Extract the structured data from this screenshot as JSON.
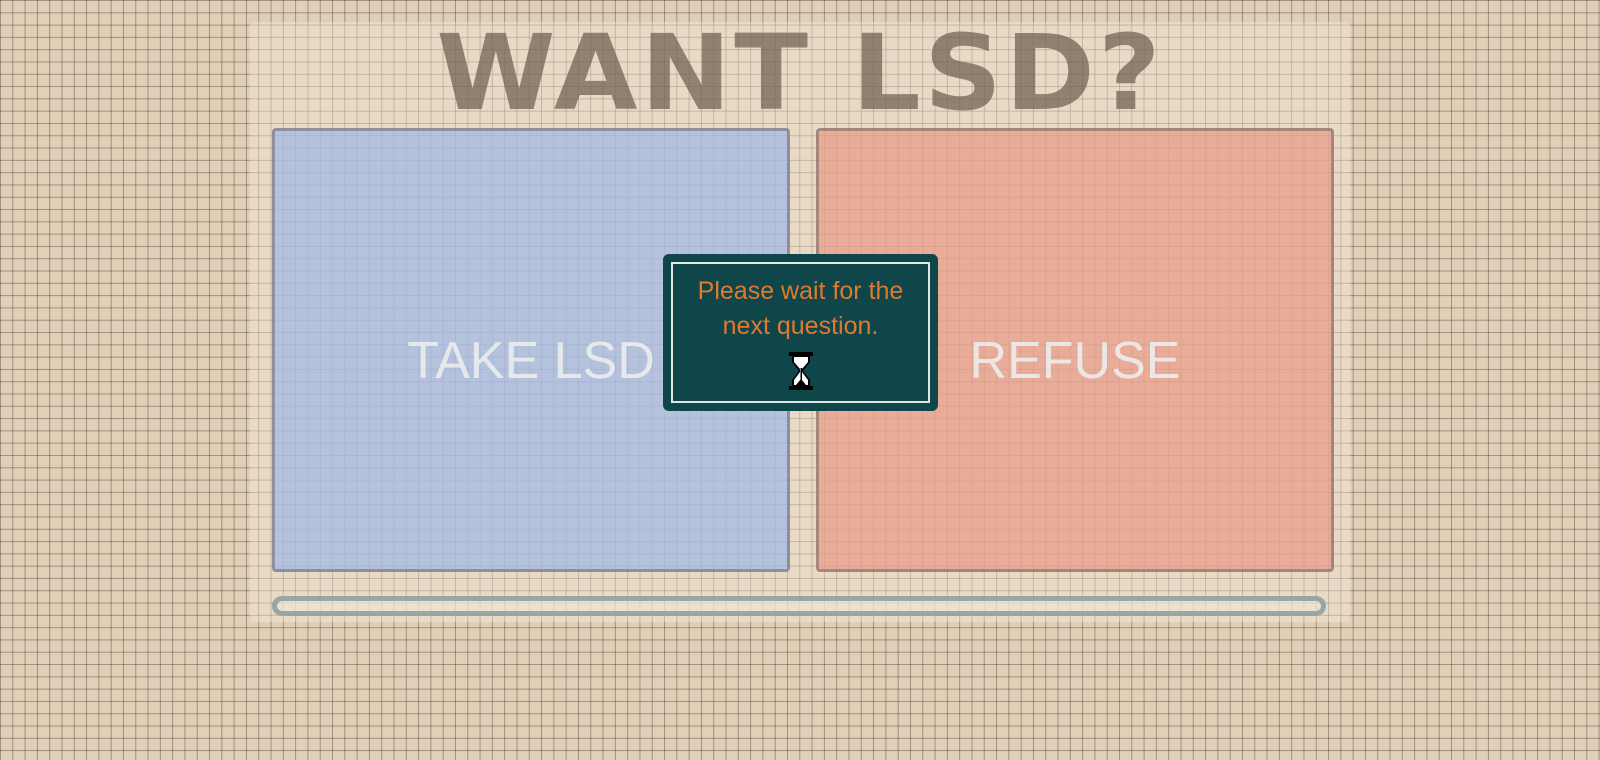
{
  "title": "WANT LSD?",
  "choices": {
    "take_label": "TAKE LSD",
    "refuse_label": "REFUSE"
  },
  "modal": {
    "message": "Please wait for the next question.",
    "icon": "hourglass-icon"
  },
  "progress": {
    "fraction": 0
  },
  "colors": {
    "take": "#a0b8e8",
    "refuse": "#e89a88",
    "modal_bg": "#0e464a",
    "modal_text": "#e2792f"
  }
}
